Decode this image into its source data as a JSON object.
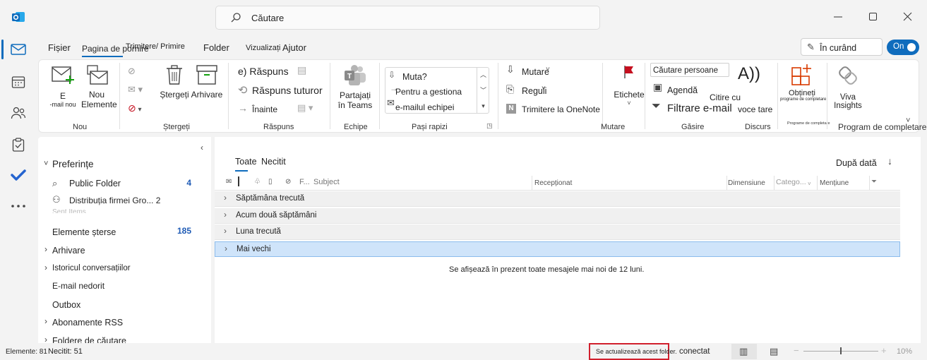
{
  "search": {
    "placeholder": "Căutare"
  },
  "menu": {
    "tabs": [
      "Fișier",
      "Pagina de pornire",
      "Trimitere/ Primire",
      "Folder",
      "Vizualizați",
      "Ajutor"
    ],
    "coming_soon": "În curând",
    "toggle": "On"
  },
  "ribbon": {
    "new_email_line1": "E",
    "new_email_line2": "-mail nou",
    "new_items_line1": "Nou",
    "new_items_line2": "Elemente",
    "delete": "Ștergeți",
    "archive": "Arhivare",
    "reply": "e) Răspuns",
    "reply_all": "Răspuns tuturor",
    "forward": "Înainte",
    "share_teams_1": "Partajați",
    "share_teams_2": "în Teams",
    "qs_1": "Muta?",
    "qs_2": "Pentru a gestiona",
    "qs_3": "e-mailul echipei",
    "move": "Mutare",
    "rules": "Reguli",
    "onenote": "Trimitere la OneNote",
    "tags": "Etichete",
    "search_people": "Căutare persoane",
    "address_book": "Agendă",
    "filter_email": "Filtrare e-mail",
    "read_aloud_1": "Citire cu",
    "read_aloud_2": "voce tare",
    "read_aloud_icon": "A))",
    "get_addins_1": "Obțineți",
    "get_addins_2": "programe de completare",
    "viva_1": "Viva",
    "viva_2": "Insights",
    "groups": {
      "new": "Nou",
      "delete": "Ștergeți",
      "respond": "Răspuns",
      "teams": "Echipe",
      "quick_steps": "Pași rapizi",
      "move": "Mutare",
      "find": "Găsire",
      "speech": "Discurs",
      "addins_small": "Programe de completare",
      "addins": "Program de completare"
    }
  },
  "folders": {
    "favorites": "Preferințe",
    "public_folder": "Public Folder",
    "public_folder_count": "4",
    "distribution": "Distribuția firmei Gro... 2",
    "sent_items": "Sent Items",
    "deleted": "Elemente șterse",
    "deleted_count": "185",
    "archive": "Arhivare",
    "conversation_history": "Istoricul conversațiilor",
    "junk": "E-mail nedorit",
    "outbox": "Outbox",
    "rss": "Abonamente RSS",
    "search_folders": "Foldere de căutare"
  },
  "list": {
    "tab_all": "Toate",
    "tab_unread": "Necitit",
    "sort": "După dată",
    "columns": {
      "from": "F...",
      "subject": "Subject",
      "received": "Recepționat",
      "size": "Dimensiune",
      "categories": "Catego...",
      "mention": "Mențiune"
    },
    "groups": [
      "Săptămâna trecută",
      "Acum două săptămâni",
      "Luna trecută",
      "Mai vechi"
    ],
    "info": "Se afișează în prezent toate mesajele mai noi de 12 luni."
  },
  "status": {
    "items": "Elemente: 81",
    "unread": "Necitit: 51",
    "updating": "Se actualizează acest folder.",
    "connected": "conectat",
    "zoom": "10%"
  }
}
